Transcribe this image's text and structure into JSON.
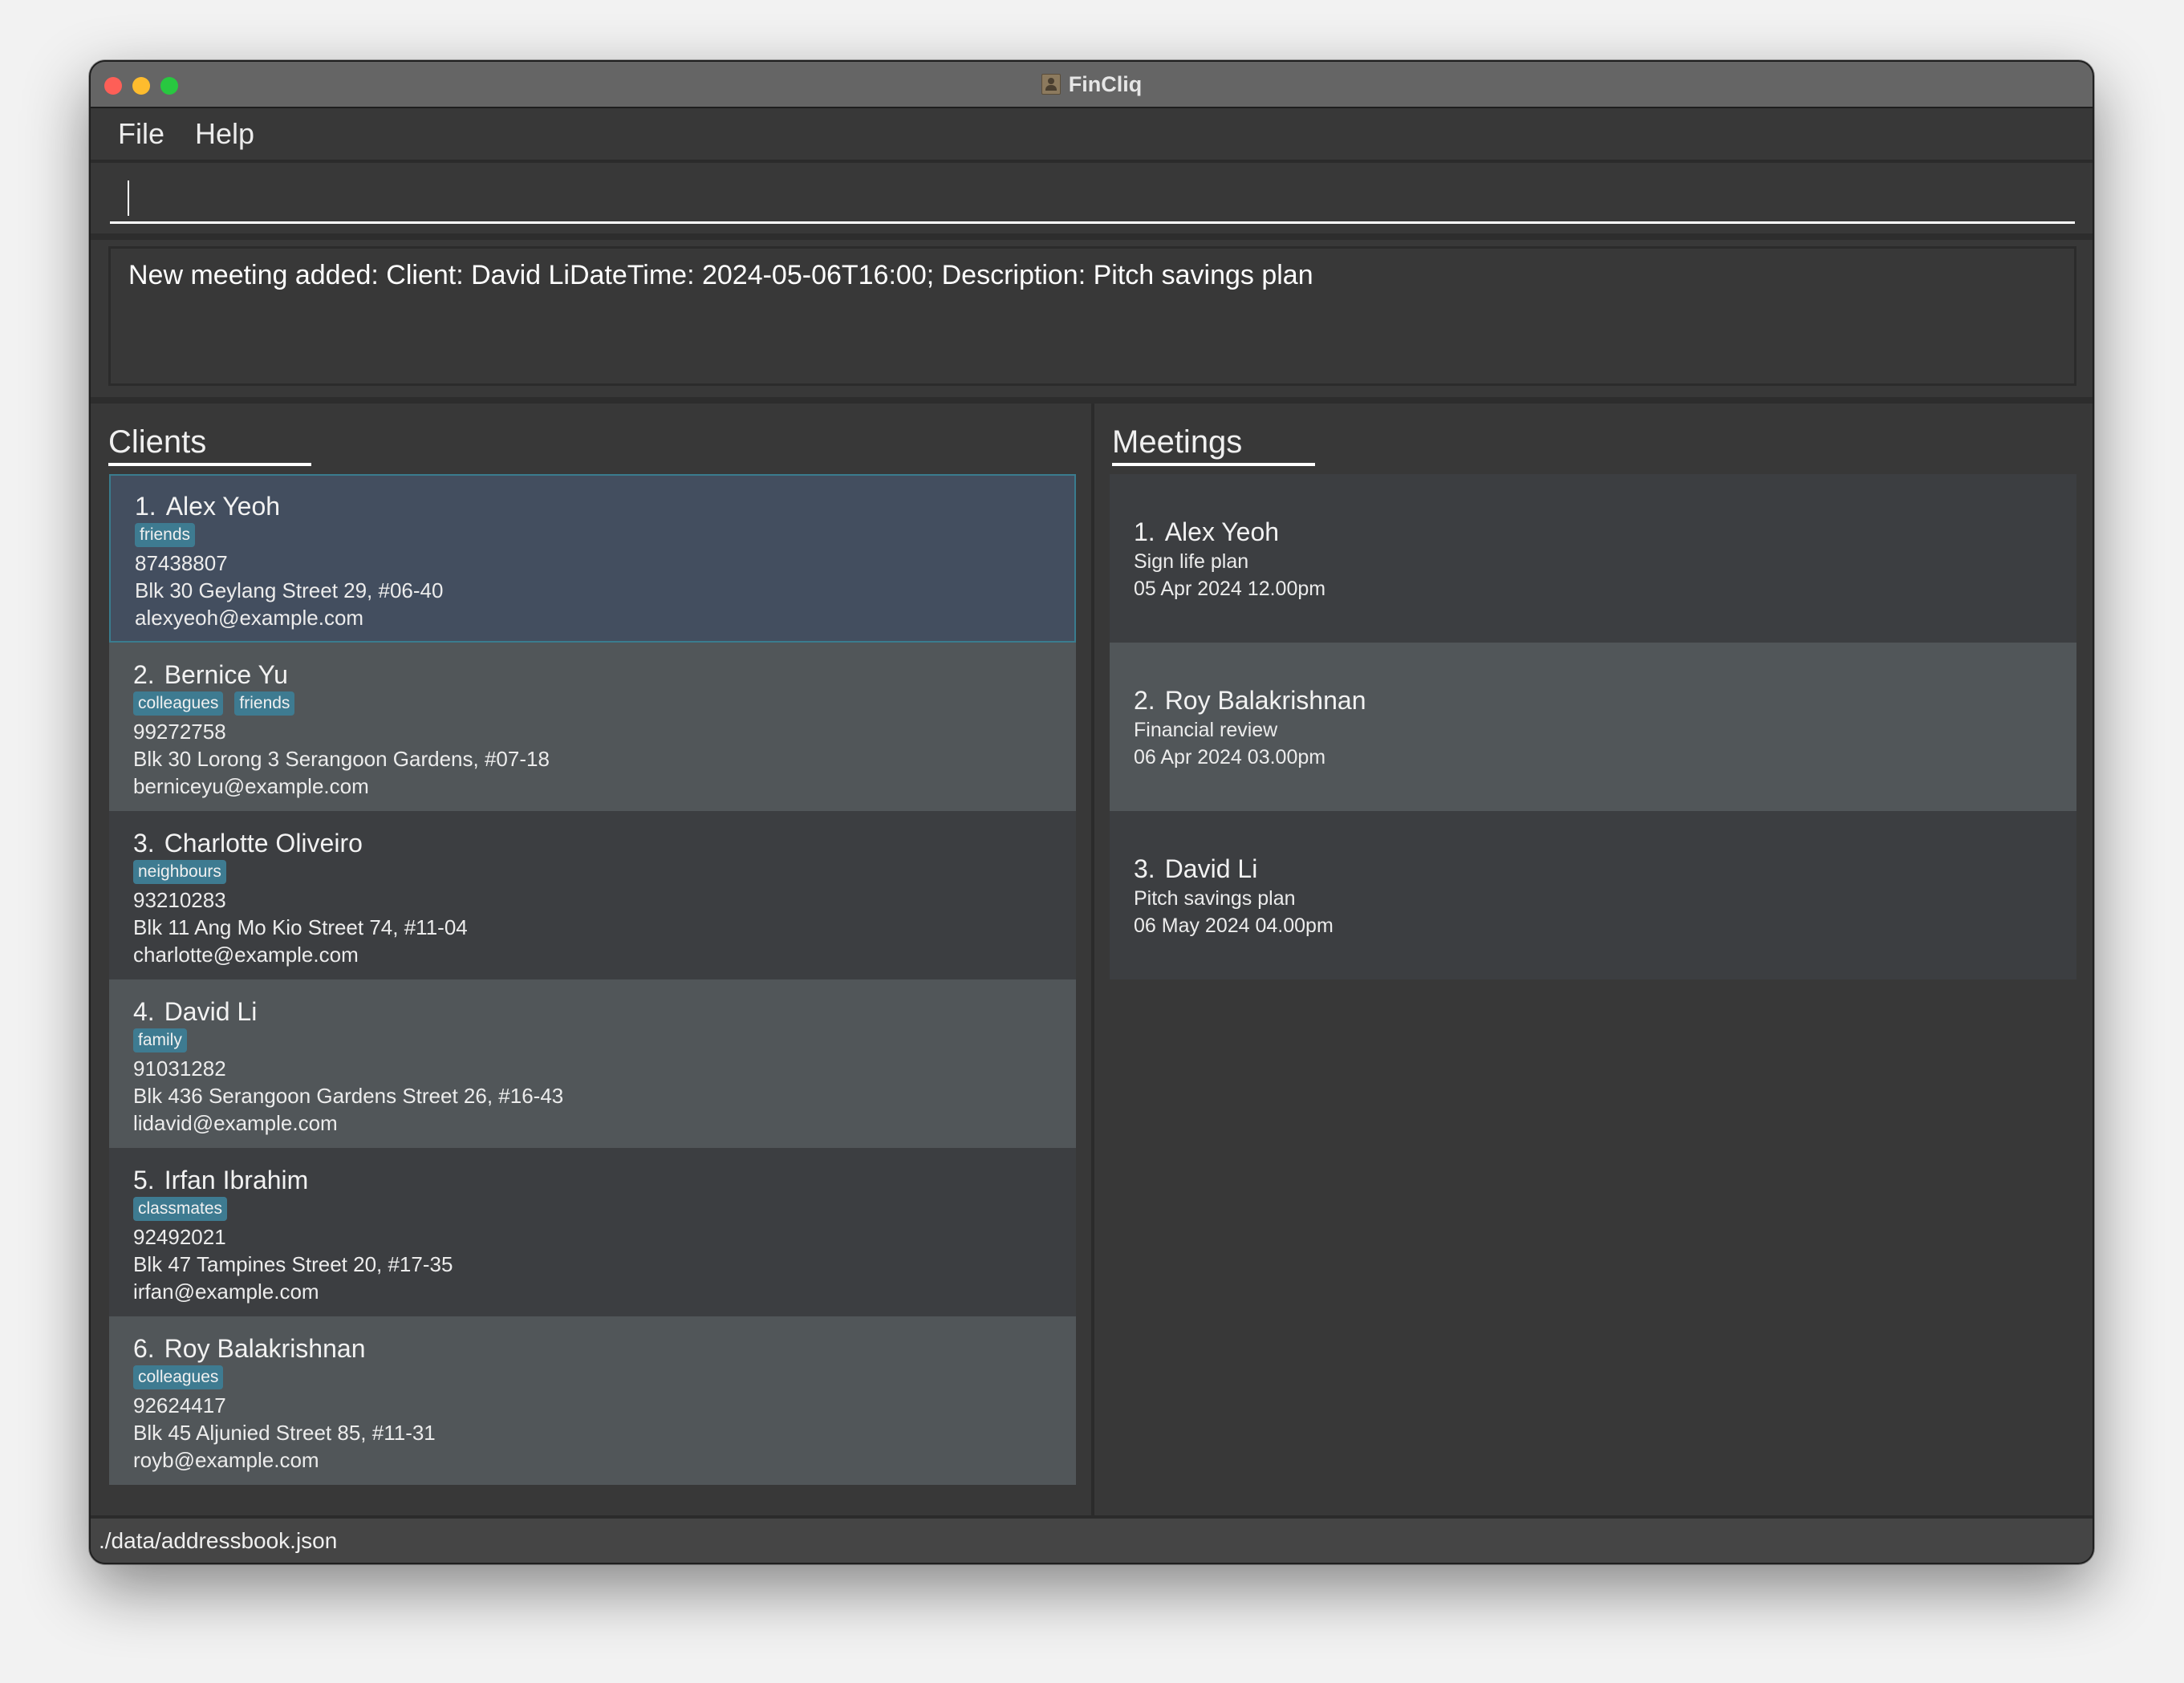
{
  "window": {
    "title": "FinCliq",
    "app_icon": "address-book-icon"
  },
  "menu": {
    "items": [
      {
        "label": "File"
      },
      {
        "label": "Help"
      }
    ]
  },
  "command_box": {
    "value": "",
    "placeholder": ""
  },
  "result_display": {
    "text": "New meeting added: Client: David LiDateTime: 2024-05-06T16:00; Description: Pitch savings plan"
  },
  "clients": {
    "title": "Clients",
    "items": [
      {
        "index": "1.",
        "name": "Alex Yeoh",
        "tags": [
          "friends"
        ],
        "phone": "87438807",
        "address": "Blk 30 Geylang Street 29, #06-40",
        "email": "alexyeoh@example.com",
        "selected": true
      },
      {
        "index": "2.",
        "name": "Bernice Yu",
        "tags": [
          "colleagues",
          "friends"
        ],
        "phone": "99272758",
        "address": "Blk 30 Lorong 3 Serangoon Gardens, #07-18",
        "email": "berniceyu@example.com",
        "selected": false
      },
      {
        "index": "3.",
        "name": "Charlotte Oliveiro",
        "tags": [
          "neighbours"
        ],
        "phone": "93210283",
        "address": "Blk 11 Ang Mo Kio Street 74, #11-04",
        "email": "charlotte@example.com",
        "selected": false
      },
      {
        "index": "4.",
        "name": "David Li",
        "tags": [
          "family"
        ],
        "phone": "91031282",
        "address": "Blk 436 Serangoon Gardens Street 26, #16-43",
        "email": "lidavid@example.com",
        "selected": false
      },
      {
        "index": "5.",
        "name": "Irfan Ibrahim",
        "tags": [
          "classmates"
        ],
        "phone": "92492021",
        "address": "Blk 47 Tampines Street 20, #17-35",
        "email": "irfan@example.com",
        "selected": false
      },
      {
        "index": "6.",
        "name": "Roy Balakrishnan",
        "tags": [
          "colleagues"
        ],
        "phone": "92624417",
        "address": "Blk 45 Aljunied Street 85, #11-31",
        "email": "royb@example.com",
        "selected": false
      }
    ]
  },
  "meetings": {
    "title": "Meetings",
    "items": [
      {
        "index": "1.",
        "client": "Alex Yeoh",
        "description": "Sign life plan",
        "datetime": "05 Apr 2024 12.00pm"
      },
      {
        "index": "2.",
        "client": "Roy Balakrishnan",
        "description": "Financial review",
        "datetime": "06 Apr 2024 03.00pm"
      },
      {
        "index": "3.",
        "client": "David Li",
        "description": "Pitch savings plan",
        "datetime": "06 May 2024 04.00pm"
      }
    ]
  },
  "status_bar": {
    "file_path": "./data/addressbook.json"
  },
  "colors": {
    "tag_background": "#3e7b91",
    "selected_card_background": "#434e5f",
    "selected_card_border": "#3a7c8e",
    "close_button": "#fe5f57",
    "minimize_button": "#febc2e",
    "maximize_button": "#28c840"
  }
}
